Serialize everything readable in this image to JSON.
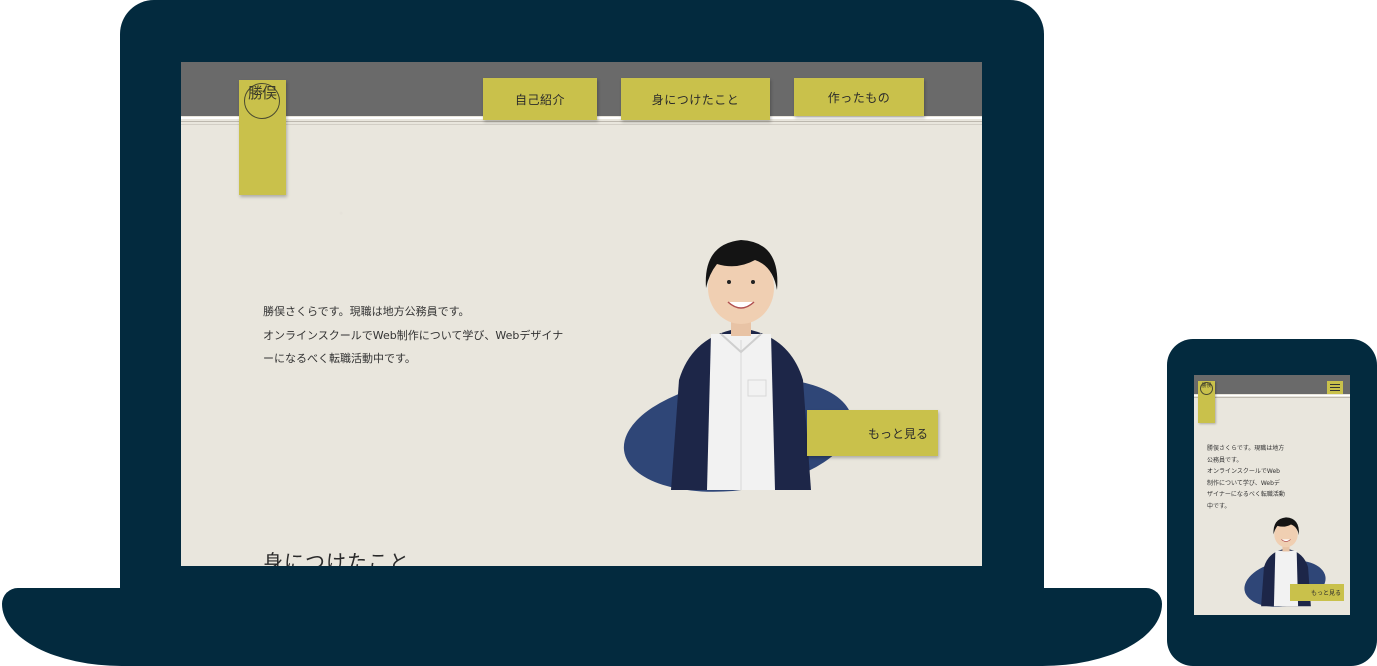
{
  "desktop": {
    "logo_text": "勝俣",
    "nav": [
      {
        "label": "自己紹介"
      },
      {
        "label": "身につけたこと"
      },
      {
        "label": "作ったもの"
      }
    ],
    "intro_lines": [
      "勝俣さくらです。現職は地方公務員です。",
      "オンラインスクールでWeb制作について学び、Webデザイナ",
      "ーになるべく転職活動中です。"
    ],
    "more_button": "もっと見る",
    "section_heading": "身につけたこと"
  },
  "mobile": {
    "logo_text": "勝俣",
    "intro_lines": [
      "勝俣さくらです。現職は地方",
      "公務員です。",
      "オンラインスクールでWeb",
      "制作について学び、Webデ",
      "ザイナーになるべく転職活動",
      "中です。"
    ],
    "more_button": "もっと見る"
  },
  "colors": {
    "device_frame": "#032a3e",
    "paper": "#e9e6dd",
    "header": "#6a6a6a",
    "accent": "#c9c14b",
    "blob": "#2f4677"
  }
}
